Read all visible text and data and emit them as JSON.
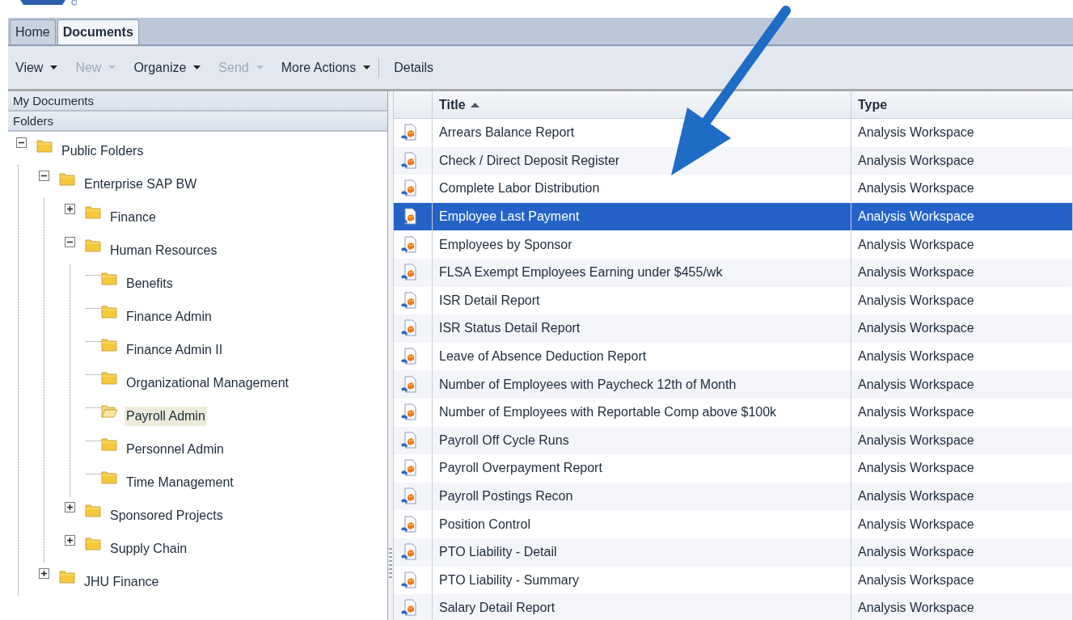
{
  "tabs": [
    {
      "label": "Home",
      "selected": false
    },
    {
      "label": "Documents",
      "selected": true
    }
  ],
  "toolbar": [
    {
      "label": "View",
      "disabled": false,
      "menu": true
    },
    {
      "label": "New",
      "disabled": true,
      "menu": true
    },
    {
      "label": "Organize",
      "disabled": false,
      "menu": true
    },
    {
      "label": "Send",
      "disabled": true,
      "menu": true
    },
    {
      "label": "More Actions",
      "disabled": false,
      "menu": true
    },
    {
      "label": "Details",
      "disabled": false,
      "menu": false
    }
  ],
  "sidebar": {
    "sections": [
      "My Documents",
      "Folders"
    ],
    "tree": [
      {
        "label": "Public Folders",
        "expanded": true,
        "selected": false,
        "children": [
          {
            "label": "Enterprise SAP BW",
            "expanded": true,
            "selected": false,
            "children": [
              {
                "label": "Finance",
                "expanded": false,
                "selected": false
              },
              {
                "label": "Human Resources",
                "expanded": true,
                "selected": false,
                "children": [
                  {
                    "label": "Benefits",
                    "selected": false
                  },
                  {
                    "label": "Finance Admin",
                    "selected": false
                  },
                  {
                    "label": "Finance Admin II",
                    "selected": false
                  },
                  {
                    "label": "Organizational Management",
                    "selected": false
                  },
                  {
                    "label": "Payroll Admin",
                    "selected": true
                  },
                  {
                    "label": "Personnel Admin",
                    "selected": false
                  },
                  {
                    "label": "Time Management",
                    "selected": false
                  }
                ]
              },
              {
                "label": "Sponsored Projects",
                "expanded": false,
                "selected": false
              },
              {
                "label": "Supply Chain",
                "expanded": false,
                "selected": false
              }
            ]
          },
          {
            "label": "JHU Finance",
            "expanded": false,
            "selected": false
          }
        ]
      }
    ]
  },
  "table": {
    "columns": [
      {
        "label": "Title",
        "sorted": true
      },
      {
        "label": "Type",
        "sorted": false
      }
    ],
    "rows": [
      {
        "title": "Arrears Balance Report",
        "type": "Analysis Workspace",
        "selected": false
      },
      {
        "title": "Check / Direct Deposit Register",
        "type": "Analysis Workspace",
        "selected": false
      },
      {
        "title": "Complete Labor Distribution",
        "type": "Analysis Workspace",
        "selected": false
      },
      {
        "title": "Employee Last Payment",
        "type": "Analysis Workspace",
        "selected": true
      },
      {
        "title": "Employees by Sponsor",
        "type": "Analysis Workspace",
        "selected": false
      },
      {
        "title": "FLSA Exempt Employees Earning under $455/wk",
        "type": "Analysis Workspace",
        "selected": false
      },
      {
        "title": "ISR Detail Report",
        "type": "Analysis Workspace",
        "selected": false
      },
      {
        "title": "ISR Status Detail Report",
        "type": "Analysis Workspace",
        "selected": false
      },
      {
        "title": "Leave of Absence Deduction Report",
        "type": "Analysis Workspace",
        "selected": false
      },
      {
        "title": "Number of Employees with Paycheck 12th of Month",
        "type": "Analysis Workspace",
        "selected": false
      },
      {
        "title": "Number of Employees with Reportable Comp above $100k",
        "type": "Analysis Workspace",
        "selected": false
      },
      {
        "title": "Payroll Off Cycle Runs",
        "type": "Analysis Workspace",
        "selected": false
      },
      {
        "title": "Payroll Overpayment Report",
        "type": "Analysis Workspace",
        "selected": false
      },
      {
        "title": "Payroll Postings Recon",
        "type": "Analysis Workspace",
        "selected": false
      },
      {
        "title": "Position Control",
        "type": "Analysis Workspace",
        "selected": false
      },
      {
        "title": "PTO Liability - Detail",
        "type": "Analysis Workspace",
        "selected": false
      },
      {
        "title": "PTO Liability - Summary",
        "type": "Analysis Workspace",
        "selected": false
      },
      {
        "title": "Salary Detail Report",
        "type": "Analysis Workspace",
        "selected": false
      }
    ]
  }
}
